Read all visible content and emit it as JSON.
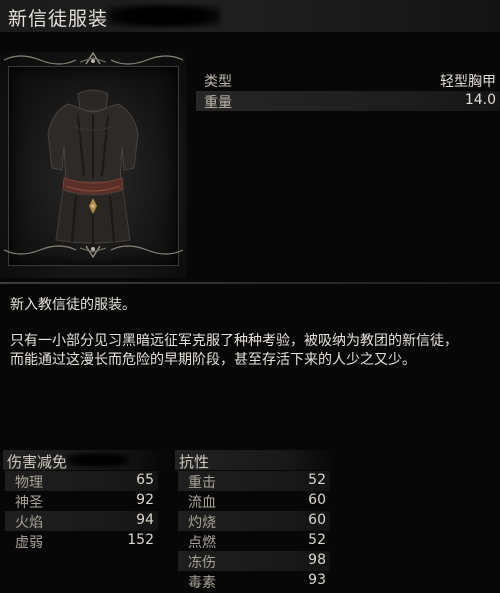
{
  "item": {
    "name": "新信徒服装"
  },
  "stats": [
    {
      "label": "类型",
      "value": "轻型胸甲"
    },
    {
      "label": "重量",
      "value": "14.0"
    }
  ],
  "description": {
    "line1": "新入教信徒的服装。",
    "line2": "只有一小部分见习黑暗远征军克服了种种考验，被吸纳为教团的新信徒，",
    "line3": "而能通过这漫长而危险的早期阶段，甚至存活下来的人少之又少。"
  },
  "damage_reduction": {
    "title": "伤害减免",
    "rows": [
      {
        "label": "物理",
        "value": "65"
      },
      {
        "label": "神圣",
        "value": "92"
      },
      {
        "label": "火焰",
        "value": "94"
      },
      {
        "label": "虚弱",
        "value": "152"
      }
    ]
  },
  "resistance": {
    "title": "抗性",
    "rows": [
      {
        "label": "重击",
        "value": "52"
      },
      {
        "label": "流血",
        "value": "60"
      },
      {
        "label": "灼烧",
        "value": "60"
      },
      {
        "label": "点燃",
        "value": "52"
      },
      {
        "label": "冻伤",
        "value": "98"
      },
      {
        "label": "毒素",
        "value": "93"
      }
    ]
  },
  "icons": {
    "item_picture": "dark-robe-chest-armor-icon",
    "frame_ornament": "ornament-icon"
  }
}
